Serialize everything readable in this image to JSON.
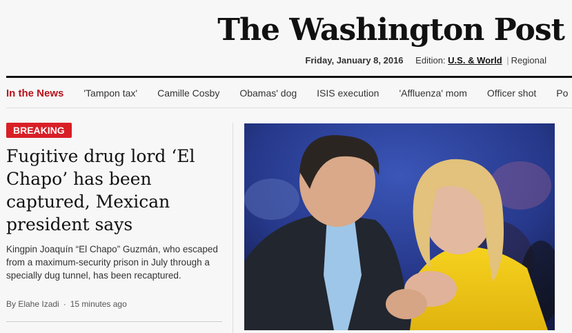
{
  "masthead": {
    "logo_text": "The Washington Post",
    "date": "Friday, January 8, 2016",
    "edition_label": "Edition:",
    "edition_current": "U.S. & World",
    "edition_separator": "|",
    "edition_other": "Regional"
  },
  "nav": {
    "label": "In the News",
    "items": [
      "'Tampon tax'",
      "Camille Cosby",
      "Obamas' dog",
      "ISIS execution",
      "'Affluenza' mom",
      "Officer shot",
      "Po"
    ]
  },
  "story": {
    "badge": "BREAKING",
    "headline": "Fugitive drug lord ‘El Chapo’ has been captured, Mexican president says",
    "dek": "Kingpin Joaquín “El Chapo” Guzmán, who escaped from a maximum-security prison in July through a specially dug tunnel, has been recaptured.",
    "author": "By Elahe Izadi",
    "time": "15 minutes ago"
  },
  "colors": {
    "accent_red": "#b5121b",
    "breaking_red": "#d91f26"
  }
}
